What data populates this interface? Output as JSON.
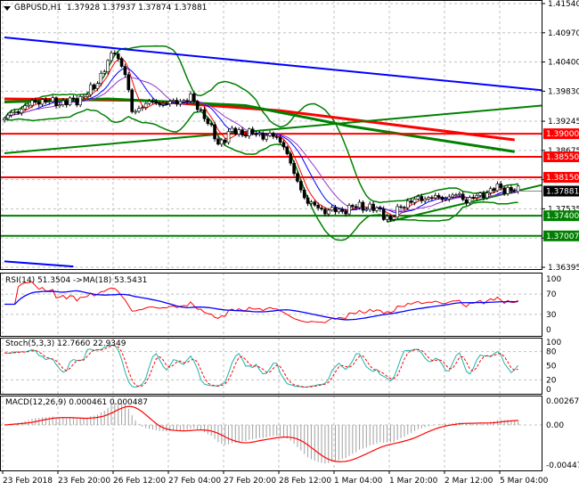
{
  "header": {
    "symbol": "GBPUSD,H1",
    "open": "1.37928",
    "high": "1.37937",
    "low": "1.37874",
    "close": "1.37881"
  },
  "indicators": {
    "rsi": "RSI(14) 51.3504  ->MA(18) 53.5431",
    "stoch": "Stoch(5,3,3) 12.7660 22.9349",
    "macd": "MACD(12,26,9) 0.000461 0.000487"
  },
  "colors": {
    "up": "#ffffff",
    "down": "#000000",
    "red": "#ff0000",
    "green": "#008000",
    "blue": "#0000ff",
    "teal": "#20b2aa",
    "gray": "#a0a0a0"
  },
  "price_axis": [
    "1.41540",
    "1.40970",
    "1.40400",
    "1.39830",
    "1.39245",
    "1.38675",
    "1.38105",
    "1.37535",
    "1.36965",
    "1.36395"
  ],
  "levels": [
    {
      "price": "1.39000",
      "color": "#ff0000"
    },
    {
      "price": "1.38550",
      "color": "#ff0000"
    },
    {
      "price": "1.38150",
      "color": "#ff0000"
    },
    {
      "price": "1.37400",
      "color": "#008000"
    },
    {
      "price": "1.37007",
      "color": "#008000"
    }
  ],
  "current_price": "1.37881",
  "rsi_axis": [
    "100",
    "70",
    "30",
    "0"
  ],
  "stoch_axis": [
    "100",
    "80",
    "50",
    "20",
    "0"
  ],
  "macd_axis": [
    "0.002676",
    "0.00",
    "-0.004477"
  ],
  "time_axis": [
    "23 Feb 2018",
    "23 Feb 20:00",
    "26 Feb 12:00",
    "27 Feb 04:00",
    "27 Feb 20:00",
    "28 Feb 12:00",
    "1 Mar 04:00",
    "1 Mar 20:00",
    "2 Mar 12:00",
    "5 Mar 04:00"
  ],
  "chart_data": {
    "type": "candlestick",
    "symbol": "GBPUSD",
    "timeframe": "H1",
    "ylim": [
      1.36395,
      1.4154
    ],
    "close_keypoints": [
      [
        0,
        1.393
      ],
      [
        5,
        1.395
      ],
      [
        10,
        1.3965
      ],
      [
        16,
        1.396
      ],
      [
        21,
        1.3965
      ],
      [
        26,
        1.399
      ],
      [
        30,
        1.404
      ],
      [
        32,
        1.406
      ],
      [
        35,
        1.402
      ],
      [
        37,
        1.394
      ],
      [
        41,
        1.396
      ],
      [
        49,
        1.396
      ],
      [
        54,
        1.397
      ],
      [
        58,
        1.3935
      ],
      [
        62,
        1.388
      ],
      [
        66,
        1.3905
      ],
      [
        72,
        1.39
      ],
      [
        78,
        1.3895
      ],
      [
        81,
        1.388
      ],
      [
        84,
        1.382
      ],
      [
        88,
        1.3765
      ],
      [
        93,
        1.375
      ],
      [
        98,
        1.375
      ],
      [
        103,
        1.376
      ],
      [
        109,
        1.375
      ],
      [
        112,
        1.373
      ],
      [
        115,
        1.376
      ],
      [
        121,
        1.3775
      ],
      [
        127,
        1.3775
      ],
      [
        132,
        1.378
      ],
      [
        134,
        1.377
      ],
      [
        138,
        1.378
      ],
      [
        143,
        1.3795
      ],
      [
        147,
        1.379
      ],
      [
        149,
        1.3788
      ]
    ],
    "trendlines": [
      {
        "name": "blue-resistance",
        "color": "#0000ff",
        "from": [
          0,
          1.4088
        ],
        "to": [
          157,
          1.3985
        ]
      },
      {
        "name": "green-support-long",
        "color": "#008000",
        "from": [
          0,
          1.3862
        ],
        "to": [
          157,
          1.3955
        ]
      },
      {
        "name": "green-support-short",
        "color": "#008000",
        "from": [
          111,
          1.3728
        ],
        "to": [
          157,
          1.38
        ]
      },
      {
        "name": "blue-lower",
        "color": "#0000ff",
        "from": [
          0,
          1.3651
        ],
        "to": [
          20,
          1.3641
        ]
      }
    ],
    "slow_ma": [
      {
        "name": "red-ma",
        "color": "#ff0000",
        "points": [
          [
            0,
            1.3968
          ],
          [
            40,
            1.3965
          ],
          [
            80,
            1.3945
          ],
          [
            110,
            1.392
          ],
          [
            148,
            1.3888
          ]
        ]
      },
      {
        "name": "green-ma",
        "color": "#008000",
        "points": [
          [
            0,
            1.3962
          ],
          [
            30,
            1.3968
          ],
          [
            70,
            1.3955
          ],
          [
            100,
            1.3915
          ],
          [
            148,
            1.3865
          ]
        ]
      }
    ]
  }
}
